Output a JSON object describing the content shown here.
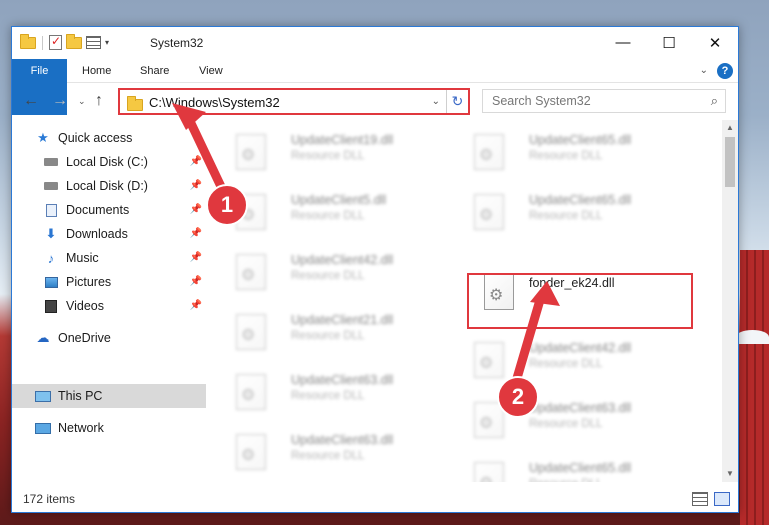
{
  "window": {
    "title": "System32",
    "controls": {
      "minimize": "—",
      "maximize": "☐",
      "close": "✕"
    }
  },
  "ribbon": {
    "tabs": [
      {
        "label": "File"
      },
      {
        "label": "Home"
      },
      {
        "label": "Share"
      },
      {
        "label": "View"
      }
    ],
    "expand_glyph": "⌄",
    "help_glyph": "?"
  },
  "nav": {
    "back": "←",
    "forward": "→",
    "recent": "⌄",
    "up": "↑"
  },
  "address": {
    "path": "C:\\Windows\\System32",
    "dropdown_glyph": "⌄",
    "refresh_glyph": "↻"
  },
  "search": {
    "placeholder": "Search System32",
    "icon_glyph": "⌕"
  },
  "sidebar": {
    "items": [
      {
        "label": "Quick access",
        "icon": "star-icon"
      },
      {
        "label": "Local Disk (C:)",
        "icon": "drive-icon",
        "pinned": true
      },
      {
        "label": "Local Disk (D:)",
        "icon": "drive-icon",
        "pinned": true
      },
      {
        "label": "Documents",
        "icon": "document-icon",
        "pinned": true
      },
      {
        "label": "Downloads",
        "icon": "download-icon",
        "pinned": true
      },
      {
        "label": "Music",
        "icon": "music-icon",
        "pinned": true
      },
      {
        "label": "Pictures",
        "icon": "pictures-icon",
        "pinned": true
      },
      {
        "label": "Videos",
        "icon": "videos-icon",
        "pinned": true
      },
      {
        "label": "OneDrive",
        "icon": "cloud-icon"
      },
      {
        "label": "This PC",
        "icon": "computer-icon",
        "selected": true
      },
      {
        "label": "Network",
        "icon": "network-icon"
      }
    ],
    "pin_glyph": "📌",
    "glyphs": {
      "star": "★",
      "download": "⬇",
      "music": "♪",
      "cloud": "☁"
    }
  },
  "files": {
    "left_column": [
      {
        "name": "UpdateClient19.dll",
        "type": "Resource DLL"
      },
      {
        "name": "UpdateClient5.dll",
        "type": "Resource DLL"
      },
      {
        "name": "UpdateClient42.dll",
        "type": "Resource DLL"
      },
      {
        "name": "UpdateClient21.dll",
        "type": "Resource DLL"
      },
      {
        "name": "UpdateClient63.dll",
        "type": "Resource DLL"
      },
      {
        "name": "UpdateClient63.dll",
        "type": "Resource DLL"
      }
    ],
    "right_column": [
      {
        "name": "UpdateClient65.dll",
        "type": "Resource DLL"
      },
      {
        "name": "UpdateClient65.dll",
        "type": "Resource DLL"
      },
      {
        "name": "fonder_ek24.dll",
        "type": "",
        "highlighted": true
      },
      {
        "name": "UpdateClient42.dll",
        "type": "Resource DLL"
      },
      {
        "name": "UpdateClient63.dll",
        "type": "Resource DLL"
      },
      {
        "name": "UpdateClient65.dll",
        "type": "Resource DLL"
      }
    ]
  },
  "status": {
    "item_count": "172 items"
  },
  "annotations": {
    "step1": "1",
    "step2": "2",
    "color": "#e0383e"
  }
}
